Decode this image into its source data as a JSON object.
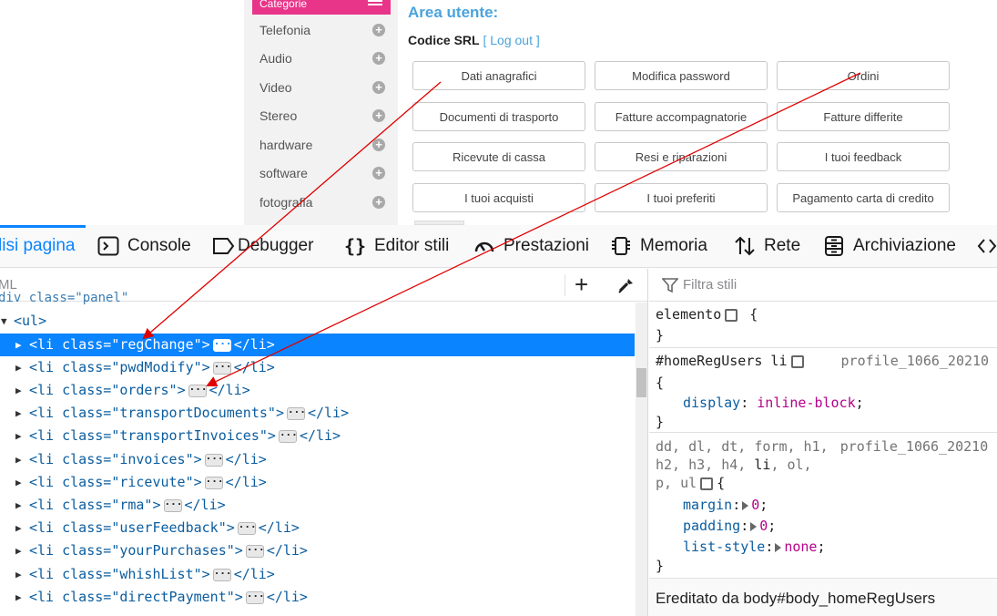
{
  "webpage": {
    "category_header": "Categorie",
    "categories": [
      "Telefonia",
      "Audio",
      "Video",
      "Stereo",
      "hardware",
      "software",
      "fotografia"
    ],
    "area_title": "Area utente:",
    "user_name": "Codice SRL",
    "logout_label": "[ Log out ]",
    "buttons": [
      "Dati anagrafici",
      "Modifica password",
      "Ordini",
      "Documenti di trasporto",
      "Fatture accompagnatorie",
      "Fatture differite",
      "Ricevute di cassa",
      "Resi e riparazioni",
      "I tuoi feedback",
      "I tuoi acquisti",
      "I tuoi preferiti",
      "Pagamento carta di credito"
    ]
  },
  "devtools": {
    "tabs": [
      {
        "label": "lisi pagina",
        "icon": "inspector-icon",
        "active": true
      },
      {
        "label": "Console",
        "icon": "console-icon"
      },
      {
        "label": "Debugger",
        "icon": "debugger-icon"
      },
      {
        "label": "Editor stili",
        "icon": "style-editor-icon"
      },
      {
        "label": "Prestazioni",
        "icon": "performance-icon"
      },
      {
        "label": "Memoria",
        "icon": "memory-icon"
      },
      {
        "label": "Rete",
        "icon": "network-icon"
      },
      {
        "label": "Archiviazione",
        "icon": "storage-icon"
      }
    ],
    "markup": {
      "search_placeholder": "ML",
      "partial_row": "div class=\"panel\"",
      "ul_tag": "<ul>",
      "rows": [
        {
          "tag_open": "<li",
          "attr": " class=",
          "value": "\"regChange\"",
          "close": ">",
          "end_tag": "</li>",
          "selected": true
        },
        {
          "tag_open": "<li",
          "attr": " class=",
          "value": "\"pwdModify\"",
          "close": ">",
          "end_tag": "</li>"
        },
        {
          "tag_open": "<li",
          "attr": " class=",
          "value": "\"orders\"",
          "close": ">",
          "end_tag": "</li>"
        },
        {
          "tag_open": "<li",
          "attr": " class=",
          "value": "\"transportDocuments\"",
          "close": ">",
          "end_tag": "</li>"
        },
        {
          "tag_open": "<li",
          "attr": " class=",
          "value": "\"transportInvoices\"",
          "close": ">",
          "end_tag": "</li>"
        },
        {
          "tag_open": "<li",
          "attr": " class=",
          "value": "\"invoices\"",
          "close": ">",
          "end_tag": "</li>"
        },
        {
          "tag_open": "<li",
          "attr": " class=",
          "value": "\"ricevute\"",
          "close": ">",
          "end_tag": "</li>"
        },
        {
          "tag_open": "<li",
          "attr": " class=",
          "value": "\"rma\"",
          "close": ">",
          "end_tag": "</li>"
        },
        {
          "tag_open": "<li",
          "attr": " class=",
          "value": "\"userFeedback\"",
          "close": ">",
          "end_tag": "</li>"
        },
        {
          "tag_open": "<li",
          "attr": " class=",
          "value": "\"yourPurchases\"",
          "close": ">",
          "end_tag": "</li>"
        },
        {
          "tag_open": "<li",
          "attr": " class=",
          "value": "\"whishList\"",
          "close": ">",
          "end_tag": "</li>"
        },
        {
          "tag_open": "<li",
          "attr": " class=",
          "value": "\"directPayment\"",
          "close": ">",
          "end_tag": "</li>"
        }
      ]
    },
    "rules": {
      "filter_placeholder": "Filtra stili",
      "element_selector": "elemento",
      "open_brace": "{",
      "close_brace": "}",
      "rule2_selector": "#homeRegUsers li",
      "rule2_source": "profile_1066_20210",
      "rule2_prop": "display",
      "rule2_value": "inline-block",
      "rule3_selector_line1": "dd, dl, dt, form, h1,",
      "rule3_source": "profile_1066_20210",
      "rule3_selector_line2a": "h2, h3, h4, ",
      "rule3_selector_li": "li",
      "rule3_selector_line2b": ", ol,",
      "rule3_selector_line3": "p, ul",
      "rule3_props": [
        {
          "prop": "margin",
          "value": "0"
        },
        {
          "prop": "padding",
          "value": "0"
        },
        {
          "prop": "list-style",
          "value": "none"
        }
      ],
      "inherited_label": "Ereditato da body#body_homeRegUsers"
    }
  },
  "colors": {
    "category_pink": "#e8358a",
    "link_blue": "#4aa3dc",
    "devtools_accent": "#0a84ff",
    "annotation_red": "#e00000"
  }
}
